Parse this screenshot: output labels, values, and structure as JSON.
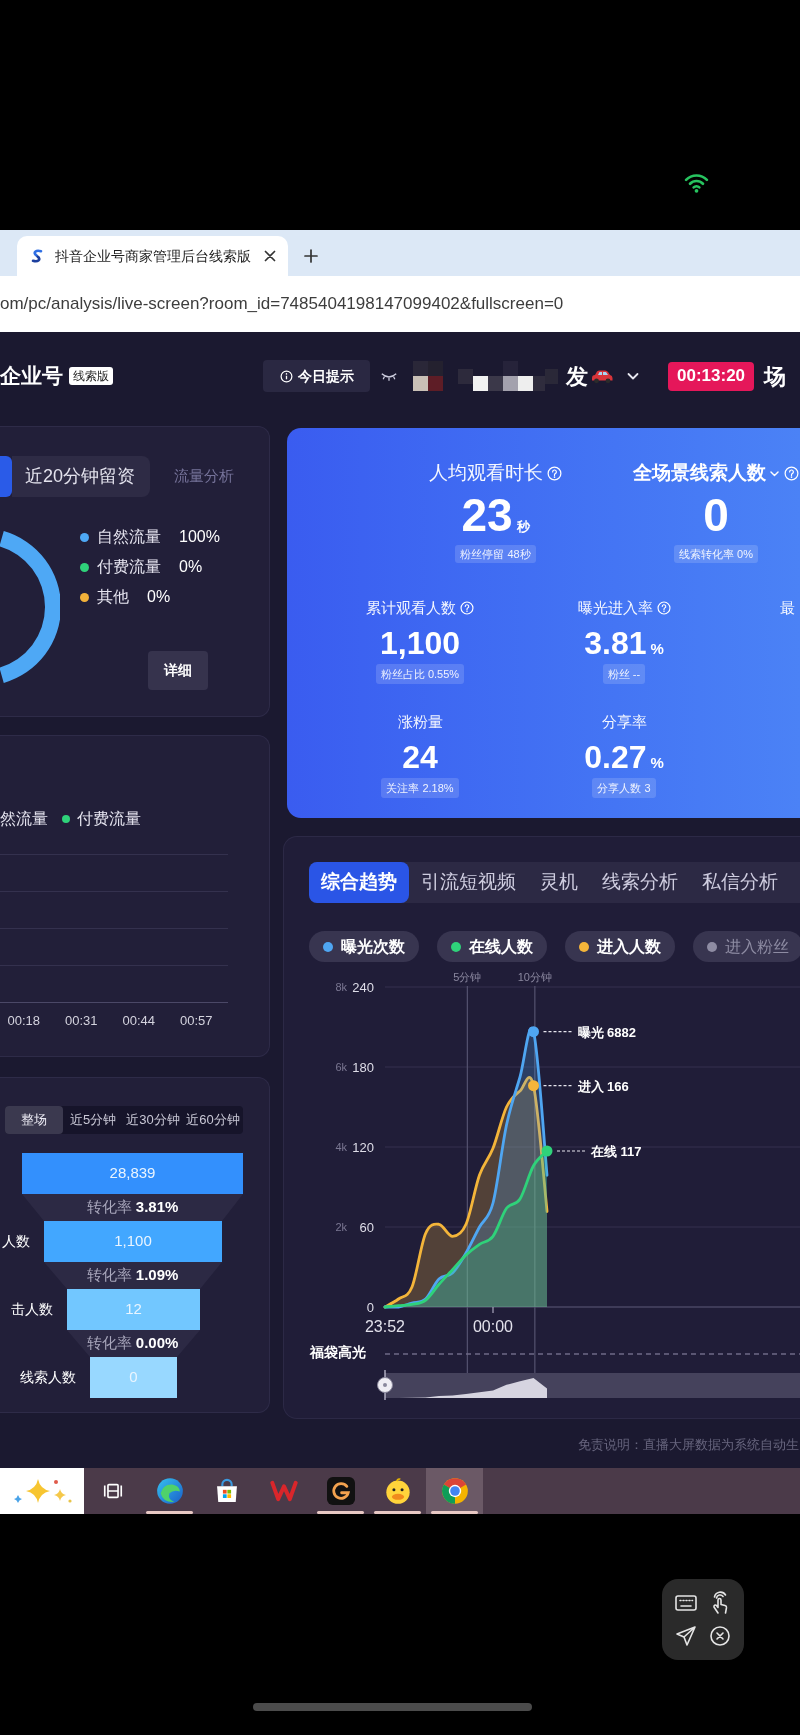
{
  "browser": {
    "tab": {
      "title": "抖音企业号商家管理后台线索版",
      "selected": true
    },
    "url": "om/pc/analysis/live-screen?room_id=7485404198147099402&fullscreen=0"
  },
  "header": {
    "brand": "企业号",
    "edition_badge": "线索版",
    "tips_button": "今日提示",
    "account_name_tail": "发",
    "timer": "00:13:20",
    "trailing_text": "场"
  },
  "traffic_panel": {
    "tabs": [
      {
        "selected": true
      },
      {
        "label": "近20分钟留资",
        "selected": false
      }
    ],
    "link": "流量分析",
    "legend": [
      {
        "label": "自然流量",
        "value": "100%",
        "color": "#4ea8f5"
      },
      {
        "label": "付费流量",
        "value": "0%",
        "color": "#2fd27a"
      },
      {
        "label": "其他",
        "value": "0%",
        "color": "#f2b13a"
      }
    ],
    "detail_button": "详细"
  },
  "source_panel": {
    "legend": [
      {
        "label": "然流量"
      },
      {
        "label": "付费流量",
        "color": "#2fd27a"
      }
    ],
    "x_labels": [
      "00:18",
      "00:31",
      "00:44",
      "00:57"
    ]
  },
  "funnel_panel": {
    "ranges": [
      {
        "label": "整场",
        "selected": true
      },
      {
        "label": "近5分钟",
        "selected": false
      },
      {
        "label": "近30分钟",
        "selected": false
      },
      {
        "label": "近60分钟",
        "selected": false
      }
    ],
    "steps": [
      {
        "value": "28,839",
        "color": "#3390fd"
      },
      {
        "label": "人数",
        "value": "1,100",
        "color": "#42a7ff"
      },
      {
        "label": "击人数",
        "value": "12",
        "color": "#72c7ff"
      },
      {
        "label": "线索人数",
        "value": "0",
        "color": "#98d8ff"
      }
    ],
    "rates": [
      "转化率 **3.81%**",
      "转化率 **1.09%**",
      "转化率 **0.00%**"
    ]
  },
  "overview": {
    "headline": [
      {
        "label": "人均观看时长",
        "help": true,
        "value": "23",
        "unit": "秒",
        "note": "粉丝停留 48秒"
      },
      {
        "label": "全场景线索人数",
        "dropdown": true,
        "help": true,
        "value": "0",
        "note": "线索转化率 0%"
      }
    ],
    "metrics": [
      {
        "label": "累计观看人数",
        "help": true,
        "value": "1,100",
        "note": "粉丝占比 0.55%"
      },
      {
        "label": "曝光进入率",
        "help": true,
        "value": "3.81",
        "unit": "%",
        "note": "粉丝 --"
      },
      {
        "label": "最"
      },
      {
        "label": "涨粉量",
        "value": "24",
        "note": "关注率 2.18%"
      },
      {
        "label": "分享率",
        "value": "0.27",
        "unit": "%",
        "note": "分享人数 3"
      }
    ]
  },
  "trend": {
    "tabs": [
      {
        "label": "综合趋势",
        "selected": true
      },
      {
        "label": "引流短视频",
        "selected": false
      },
      {
        "label": "灵机",
        "selected": false
      },
      {
        "label": "线索分析",
        "selected": false
      },
      {
        "label": "私信分析",
        "selected": false
      }
    ],
    "series_toggles": [
      {
        "on": true
      },
      {
        "on": true
      },
      {
        "on": true
      },
      {
        "label": "进入粉丝",
        "on": false
      }
    ],
    "time_markers": [
      "5分钟",
      "10分钟"
    ],
    "chart_data": {
      "type": "area",
      "stacked": false,
      "grid": true,
      "legend": "top",
      "categories": [
        "23:52",
        null,
        null,
        null,
        null,
        null,
        null,
        null,
        "00:00",
        null,
        null,
        null,
        null,
        null,
        null,
        null,
        null,
        null,
        null,
        null,
        null,
        null,
        null,
        null,
        null,
        null,
        null,
        null,
        null,
        null,
        null
      ],
      "ylim": [
        0,
        240
      ],
      "yticks": [
        0,
        60,
        120,
        180,
        240
      ],
      "y2lim": [
        0,
        8000
      ],
      "y2ticks": [
        {
          "value": 2000,
          "label": "2k"
        },
        {
          "value": 4000,
          "label": "4k"
        },
        {
          "value": 6000,
          "label": "6k"
        },
        {
          "value": 8000,
          "label": "8k"
        }
      ],
      "series": [
        {
          "name": "曝光次数",
          "color": "#4fa6f2",
          "axis": "y2",
          "values": [
            0,
            0,
            100,
            200,
            700,
            850,
            1350,
            2000,
            2600,
            4550,
            5750,
            6882,
            3300,
            null,
            null,
            null,
            null,
            null,
            null,
            null,
            null,
            null,
            null,
            null,
            null,
            null,
            null,
            null,
            null,
            null,
            null
          ]
        },
        {
          "name": "在线人数",
          "color": "#2fd27a",
          "values": [
            0,
            1,
            2,
            5,
            17,
            28,
            39,
            47,
            53,
            74,
            81,
            106,
            117,
            null,
            null,
            null,
            null,
            null,
            null,
            null,
            null,
            null,
            null,
            null,
            null,
            null,
            null,
            null,
            null,
            null,
            null
          ]
        },
        {
          "name": "进入人数",
          "color": "#f4b53a",
          "values": [
            0,
            6,
            15,
            55,
            62,
            53,
            62,
            99,
            119,
            150,
            162,
            166,
            72,
            null,
            null,
            null,
            null,
            null,
            null,
            null,
            null,
            null,
            null,
            null,
            null,
            null,
            null,
            null,
            null,
            null,
            null
          ]
        }
      ],
      "annotations": [
        "曝光 6882",
        "在线 117",
        "进入 166"
      ]
    },
    "highlight_track": {
      "label": "福袋高光"
    }
  },
  "disclaimer": "免责说明：直播大屏数据为系统自动生",
  "taskbar": {
    "apps": [
      {
        "kind": "sparkles",
        "running": false,
        "selected": false
      },
      {
        "kind": "task_view",
        "running": false,
        "selected": false
      },
      {
        "kind": "swirl_globe",
        "running": true,
        "selected": false
      },
      {
        "kind": "bag",
        "running": false,
        "selected": false
      },
      {
        "kind": "w_logo",
        "running": false,
        "selected": false
      },
      {
        "kind": "g_swirl",
        "running": true,
        "selected": false
      },
      {
        "kind": "duck",
        "running": true,
        "selected": false
      },
      {
        "kind": "tricolor",
        "running": true,
        "selected": true
      }
    ]
  }
}
